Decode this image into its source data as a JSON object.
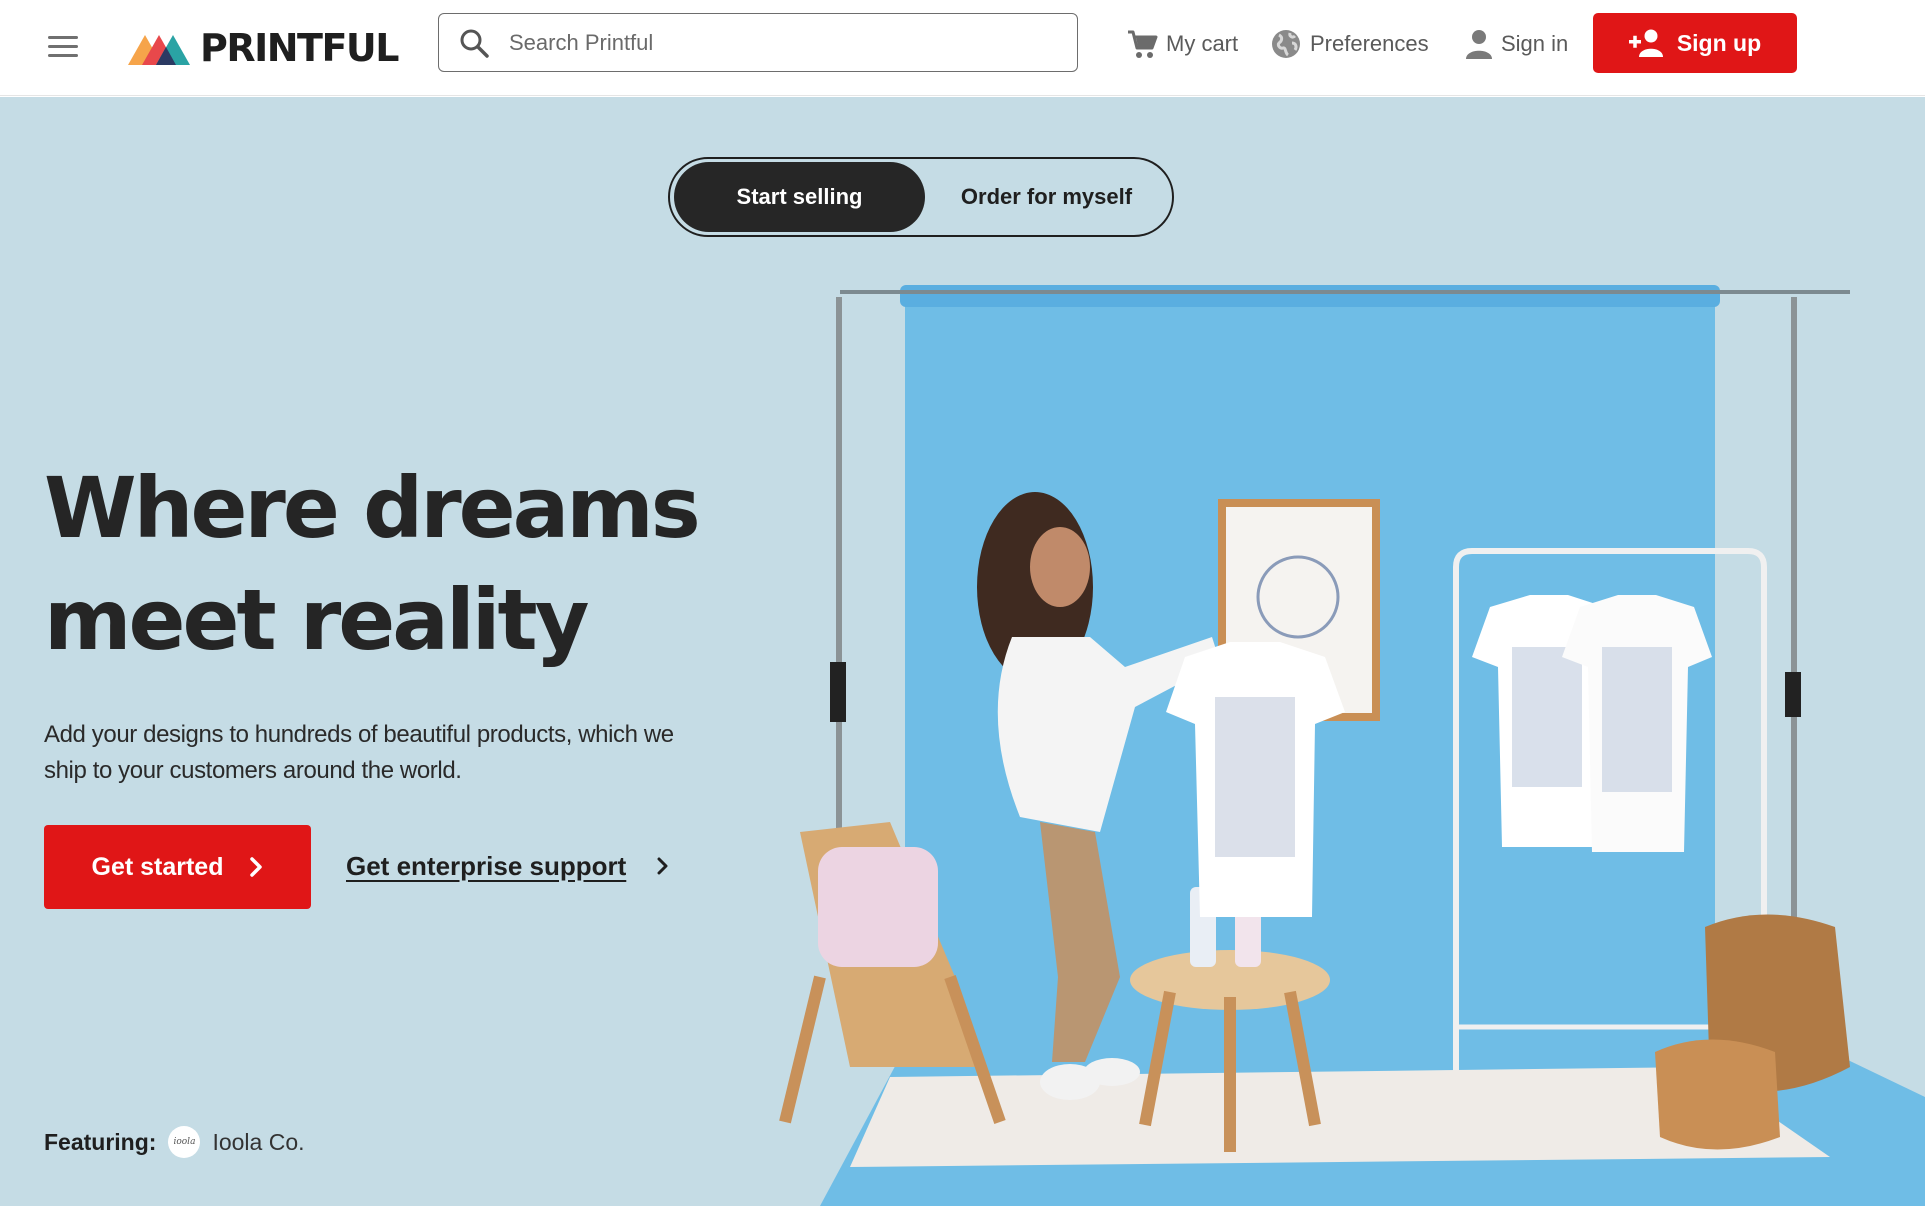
{
  "header": {
    "brand_name": "PRINTFUL",
    "search_placeholder": "Search Printful",
    "cart_label": "My cart",
    "preferences_label": "Preferences",
    "signin_label": "Sign in",
    "signup_label": "Sign up",
    "brand_color": "#e01617"
  },
  "hero": {
    "toggle": {
      "options": [
        "Start selling",
        "Order for myself"
      ],
      "selected": "Start selling"
    },
    "headline_line1": "Where dreams",
    "headline_line2": "meet reality",
    "subtext": "Add your designs to hundreds of beautiful products, which we ship to your customers around the world.",
    "primary_cta": "Get started",
    "secondary_cta": "Get enterprise support",
    "featuring_label": "Featuring:",
    "featuring_brand": "Ioola Co.",
    "background_color": "#c5dce5",
    "backdrop_color": "#6fbde6"
  },
  "icons": {
    "menu": "hamburger-icon",
    "search": "search-icon",
    "cart": "cart-icon",
    "preferences": "globe-icon",
    "signin": "user-icon",
    "signup": "add-user-icon",
    "chevron": "chevron-right-icon"
  }
}
